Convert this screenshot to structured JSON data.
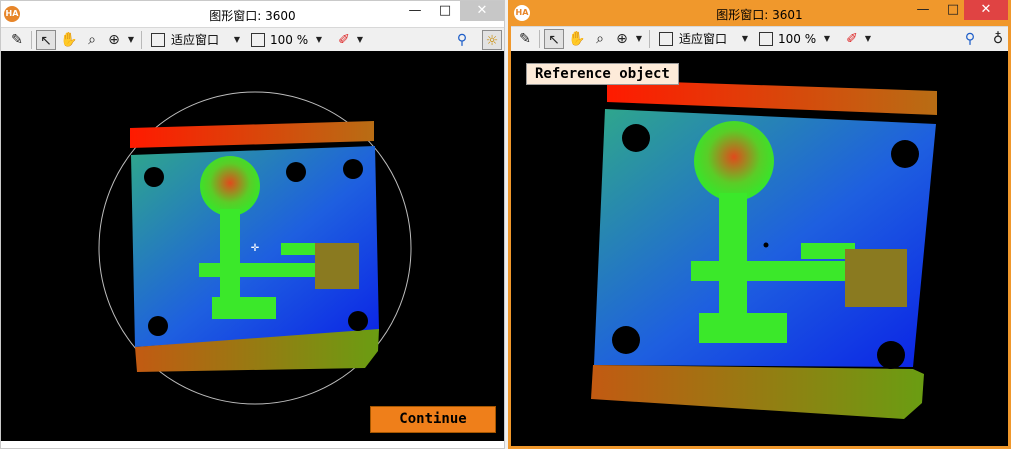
{
  "windows": {
    "left": {
      "title": "图形窗口: 3600",
      "zoom_mode": "适应窗口",
      "zoom_percent": "100 %",
      "continue_label": "Continue"
    },
    "right": {
      "title": "图形窗口: 3601",
      "zoom_mode": "适应窗口",
      "zoom_percent": "100 %",
      "reference_label": "Reference object"
    }
  },
  "titlebar": {
    "app_icon": "HA",
    "minimize": "—",
    "maximize": "□",
    "close": "✕"
  },
  "colors": {
    "accent_border": "#f0982c",
    "continue_button": "#ef7f1a",
    "label_bg": "#fdebd9"
  }
}
